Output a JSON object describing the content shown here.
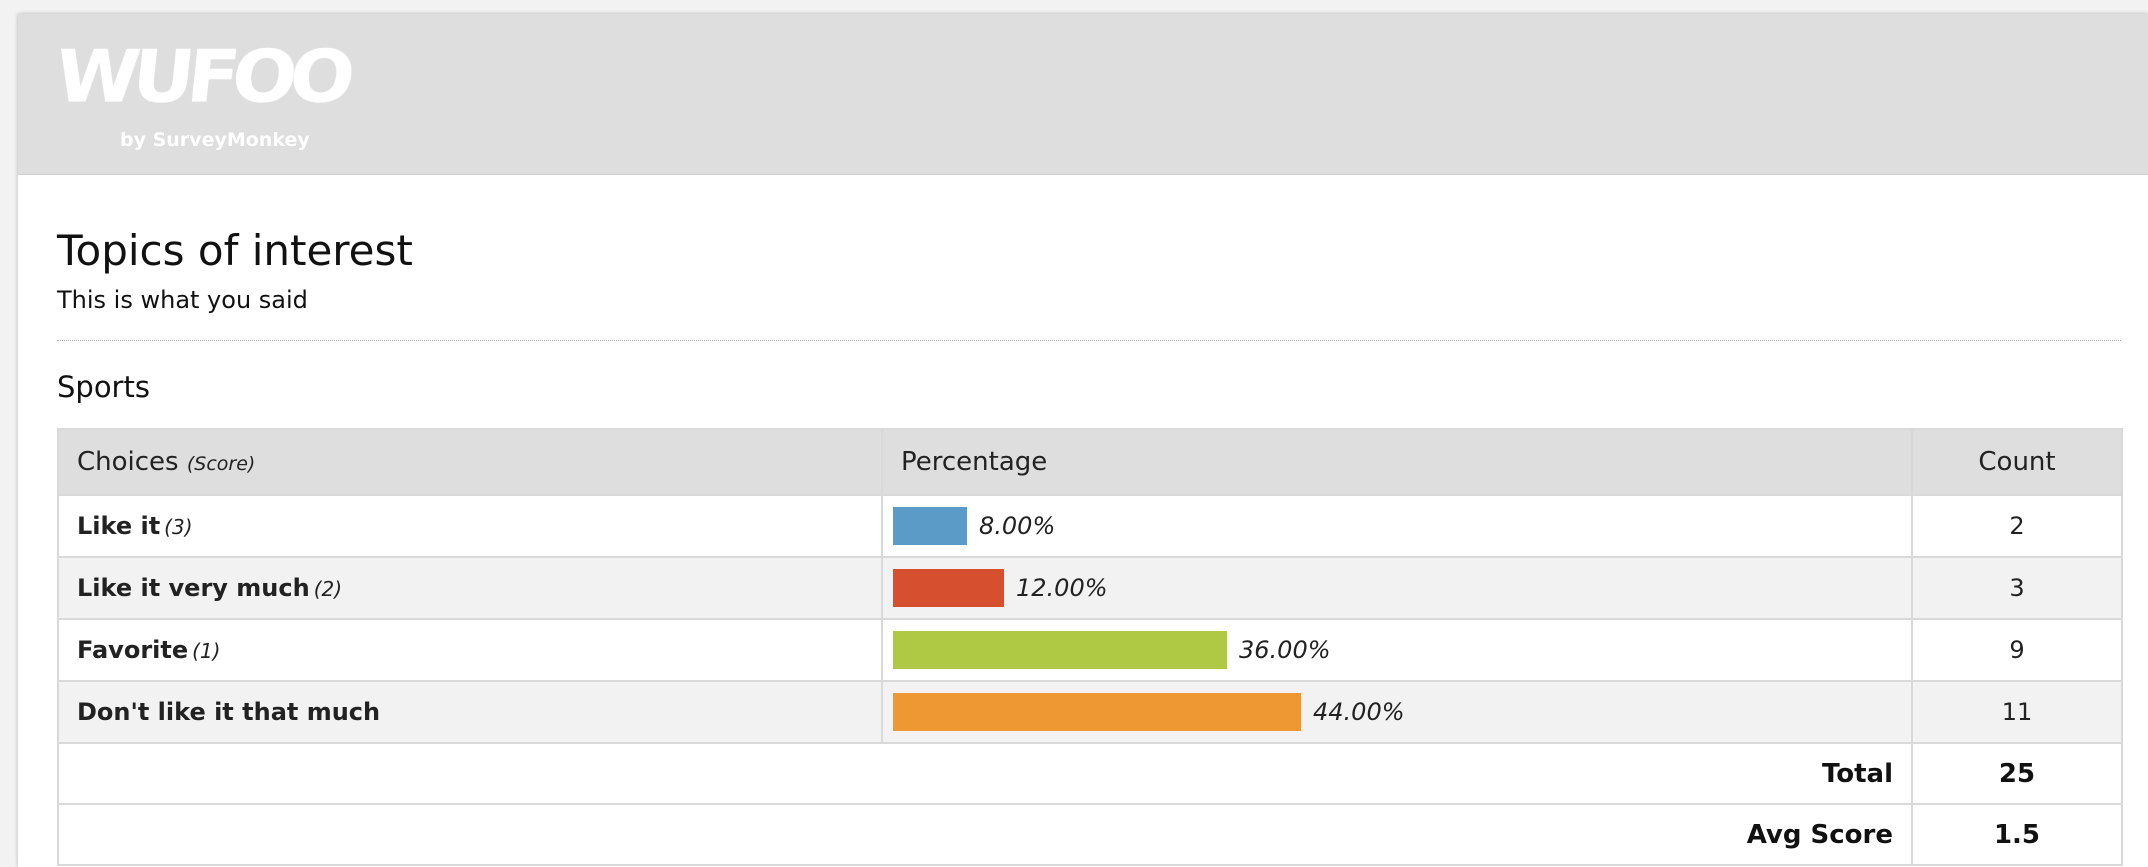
{
  "brand": {
    "logo_text": "WUFOO",
    "logo_subtext": "by SurveyMonkey"
  },
  "page": {
    "title": "Topics of interest",
    "subtitle": "This is what you said"
  },
  "section": {
    "title": "Sports"
  },
  "table": {
    "headers": {
      "choices": "Choices",
      "choices_note": "(Score)",
      "percentage": "Percentage",
      "count": "Count"
    },
    "rows": [
      {
        "choice": "Like it",
        "score": "(3)",
        "percentage": 8.0,
        "percentage_label": "8.00%",
        "count": "2",
        "color": "#5b9bc7"
      },
      {
        "choice": "Like it very much",
        "score": "(2)",
        "percentage": 12.0,
        "percentage_label": "12.00%",
        "count": "3",
        "color": "#d64f2e"
      },
      {
        "choice": "Favorite",
        "score": "(1)",
        "percentage": 36.0,
        "percentage_label": "36.00%",
        "count": "9",
        "color": "#afc944"
      },
      {
        "choice": "Don't like it that much",
        "score": "",
        "percentage": 44.0,
        "percentage_label": "44.00%",
        "count": "11",
        "color": "#ee9834"
      }
    ],
    "footer": {
      "total_label": "Total",
      "total_value": "25",
      "avg_label": "Avg Score",
      "avg_value": "1.5"
    }
  },
  "chart_data": {
    "type": "bar",
    "categories": [
      "Like it",
      "Like it very much",
      "Favorite",
      "Don't like it that much"
    ],
    "values": [
      8.0,
      12.0,
      36.0,
      44.0
    ],
    "counts": [
      2,
      3,
      9,
      11
    ],
    "colors": [
      "#5b9bc7",
      "#d64f2e",
      "#afc944",
      "#ee9834"
    ],
    "title": "Sports"
  }
}
